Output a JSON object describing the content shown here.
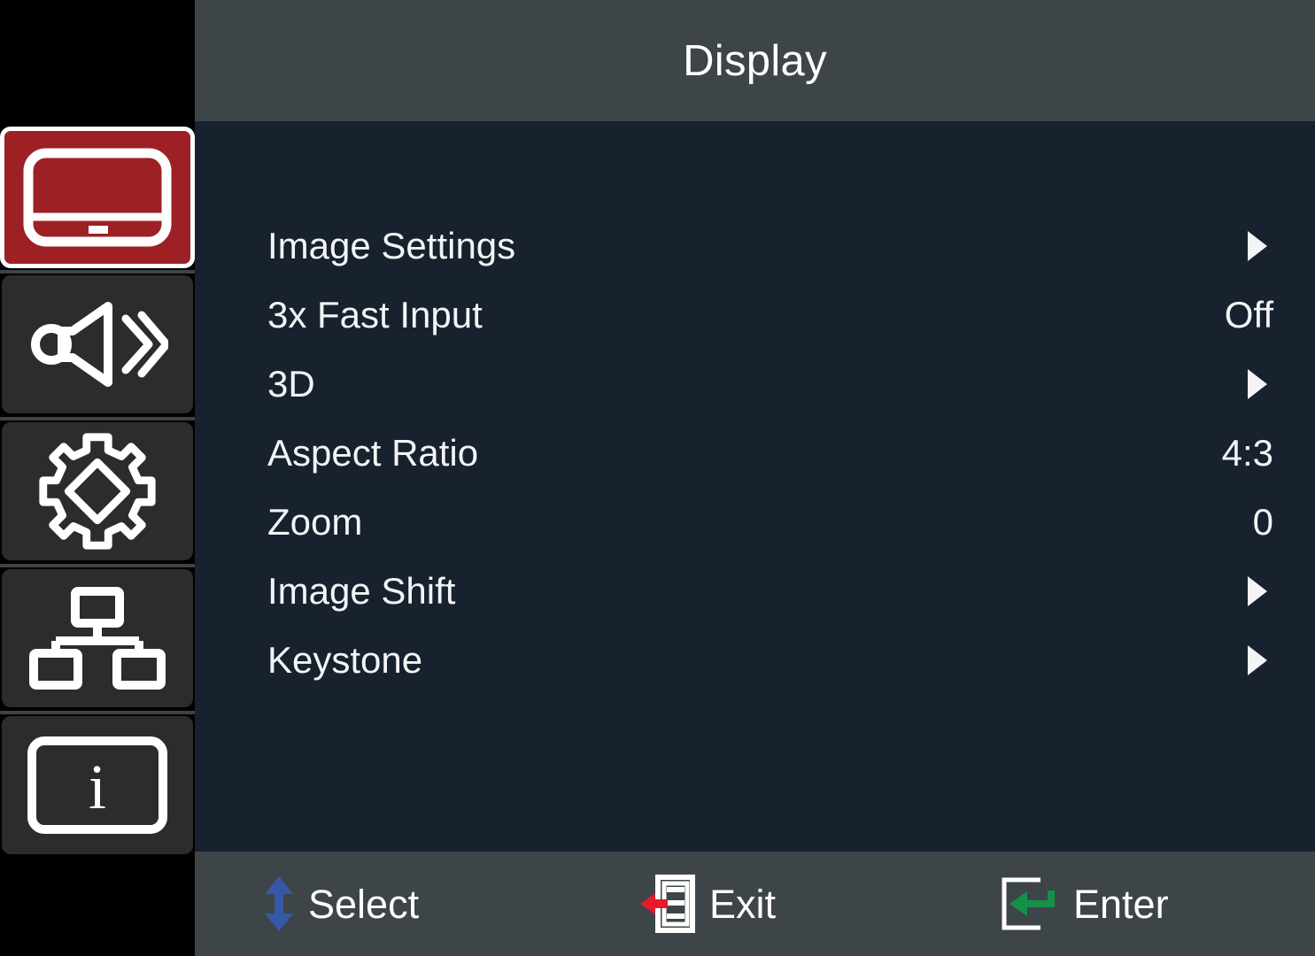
{
  "header": {
    "title": "Display"
  },
  "colors": {
    "accent_red": "#9d2025",
    "header_bg": "#3e4548",
    "content_bg": "#18212e",
    "sidebar_bg": "#000000",
    "tile_bg": "#2c2c2c",
    "text": "#f2f4f5",
    "select_arrow_blue": "#3558a8",
    "exit_arrow_red": "#e8192c",
    "enter_arrow_green": "#159048"
  },
  "sidebar": {
    "items": [
      {
        "id": "display",
        "icon": "display-icon",
        "selected": true
      },
      {
        "id": "audio",
        "icon": "audio-icon",
        "selected": false
      },
      {
        "id": "setup",
        "icon": "gear-icon",
        "selected": false
      },
      {
        "id": "network",
        "icon": "network-icon",
        "selected": false
      },
      {
        "id": "info",
        "icon": "info-icon",
        "selected": false
      }
    ]
  },
  "main": {
    "menu_items": [
      {
        "label": "Image Settings",
        "value": "",
        "indicator": "submenu-arrow-icon"
      },
      {
        "label": "3x Fast Input",
        "value": "Off",
        "indicator": "none"
      },
      {
        "label": "3D",
        "value": "",
        "indicator": "submenu-arrow-icon"
      },
      {
        "label": "Aspect Ratio",
        "value": "4:3",
        "indicator": "none"
      },
      {
        "label": "Zoom",
        "value": "0",
        "indicator": "none"
      },
      {
        "label": "Image Shift",
        "value": "",
        "indicator": "submenu-arrow-icon"
      },
      {
        "label": "Keystone",
        "value": "",
        "indicator": "submenu-arrow-icon"
      }
    ]
  },
  "bottom_bar": {
    "hints": [
      {
        "id": "select",
        "label": "Select",
        "icon": "up-down-arrow-icon"
      },
      {
        "id": "exit",
        "label": "Exit",
        "icon": "exit-menu-icon"
      },
      {
        "id": "enter",
        "label": "Enter",
        "icon": "enter-return-icon"
      }
    ]
  }
}
